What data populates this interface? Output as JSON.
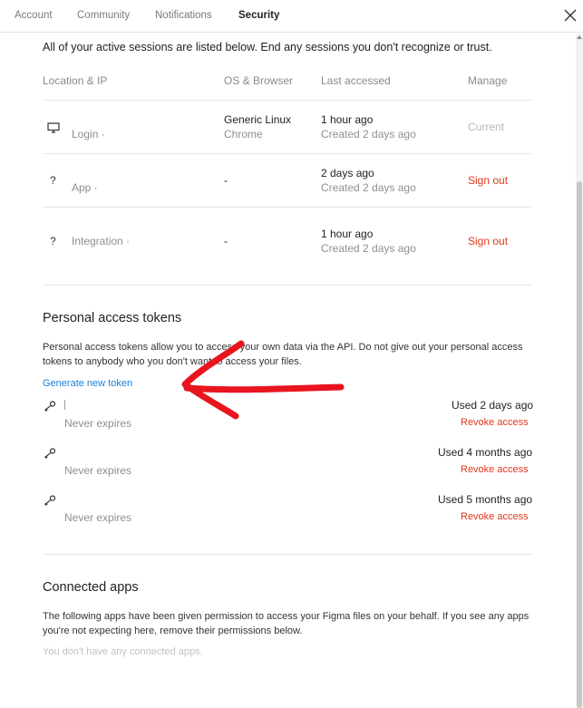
{
  "tabs": [
    {
      "label": "Account"
    },
    {
      "label": "Community"
    },
    {
      "label": "Notifications"
    },
    {
      "label": "Security"
    }
  ],
  "sessions": {
    "intro": "All of your active sessions are listed below. End any sessions you don't recognize or trust.",
    "columns": {
      "location": "Location & IP",
      "os": "OS & Browser",
      "last": "Last accessed",
      "manage": "Manage"
    },
    "rows": [
      {
        "icon": "monitor-icon",
        "location": "Login ·",
        "os_line1": "Generic Linux",
        "os_line2": "Chrome",
        "last_line1": "1 hour ago",
        "last_line2": "Created 2 days ago",
        "manage": "Current"
      },
      {
        "icon": "?",
        "location": "App ·",
        "os_line1": "-",
        "os_line2": "",
        "last_line1": "2 days ago",
        "last_line2": "Created 2 days ago",
        "manage": "Sign out"
      },
      {
        "icon": "?",
        "location": "Integration ·",
        "os_line1": "-",
        "os_line2": "",
        "last_line1": "1 hour ago",
        "last_line2": "Created 2 days ago",
        "manage": "Sign out"
      }
    ]
  },
  "tokens": {
    "title": "Personal access tokens",
    "description": "Personal access tokens allow you to access your own data via the API. Do not give out your personal access tokens to anybody who you don't want to access your files.",
    "generate_label": "Generate new token",
    "items": [
      {
        "expires": "Never expires",
        "used": "Used 2 days ago",
        "revoke": "Revoke access"
      },
      {
        "expires": "Never expires",
        "used": "Used 4 months ago",
        "revoke": "Revoke access"
      },
      {
        "expires": "Never expires",
        "used": "Used 5 months ago",
        "revoke": "Revoke access"
      }
    ]
  },
  "connected_apps": {
    "title": "Connected apps",
    "description": "The following apps have been given permission to access your Figma files on your behalf. If you see any apps you're not expecting here, remove their permissions below.",
    "empty_text": "You don't have any connected apps."
  },
  "colors": {
    "accent_red": "#e0361b",
    "link_blue": "#1a82d9",
    "annotation_arrow": "#e8141e"
  },
  "icons": [
    "close-icon",
    "monitor-icon",
    "key-icon"
  ]
}
